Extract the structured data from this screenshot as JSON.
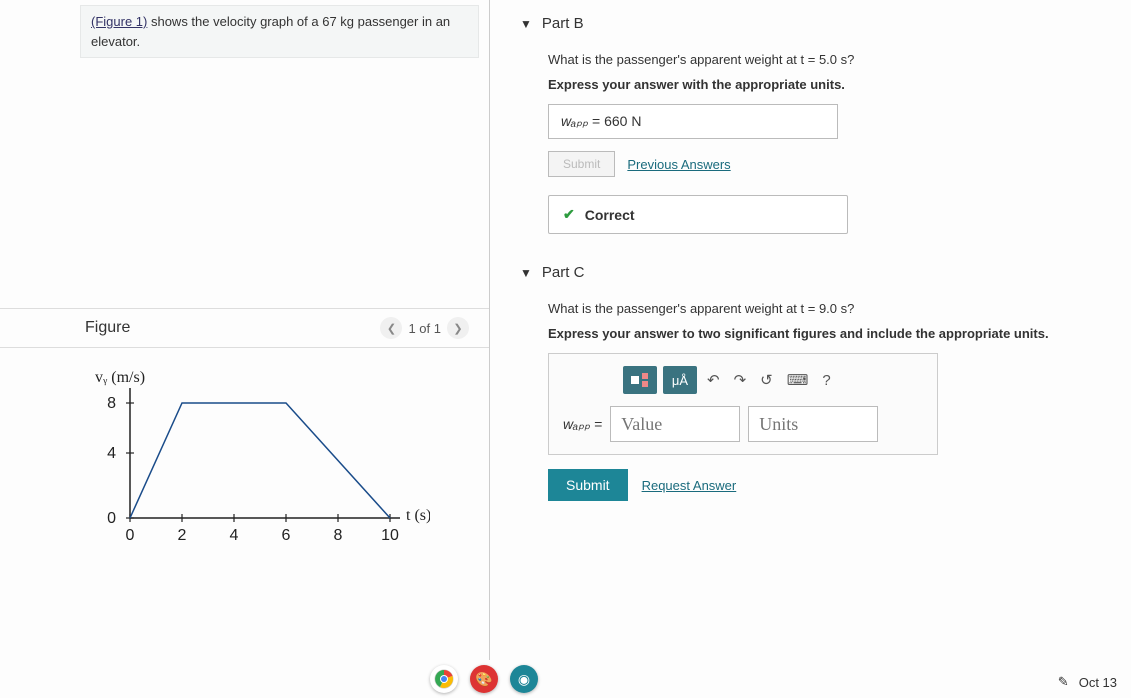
{
  "problem": {
    "fig_link": "(Figure 1)",
    "text_after": " shows the velocity graph of a 67 kg passenger in an elevator."
  },
  "figure": {
    "title": "Figure",
    "nav": "1 of 1",
    "ylabel": "vᵧ (m/s)",
    "xlabel": "t (s)"
  },
  "chart_data": {
    "type": "line",
    "x": [
      0,
      2,
      6,
      10
    ],
    "y": [
      0,
      8,
      8,
      0
    ],
    "xlabel": "t (s)",
    "ylabel": "v_y (m/s)",
    "xlim": [
      0,
      10
    ],
    "ylim": [
      0,
      8
    ],
    "xticks": [
      0,
      2,
      4,
      6,
      8,
      10
    ],
    "yticks": [
      0,
      4,
      8
    ]
  },
  "partB": {
    "title": "Part B",
    "question": "What is the passenger's apparent weight at t = 5.0 s?",
    "hint": "Express your answer with the appropriate units.",
    "var": "wₐₚₚ",
    "eq": " = ",
    "value": "660 N",
    "submit": "Submit",
    "prev": "Previous Answers",
    "correct": "Correct"
  },
  "partC": {
    "title": "Part C",
    "question": "What is the passenger's apparent weight at t = 9.0 s?",
    "hint": "Express your answer to two significant figures and include the appropriate units.",
    "var": "wₐₚₚ",
    "eq": " = ",
    "value_ph": "Value",
    "units_ph": "Units",
    "tb_units": "μÅ",
    "help": "?",
    "submit": "Submit",
    "request": "Request Answer"
  },
  "clock": {
    "date": "Oct 13"
  }
}
